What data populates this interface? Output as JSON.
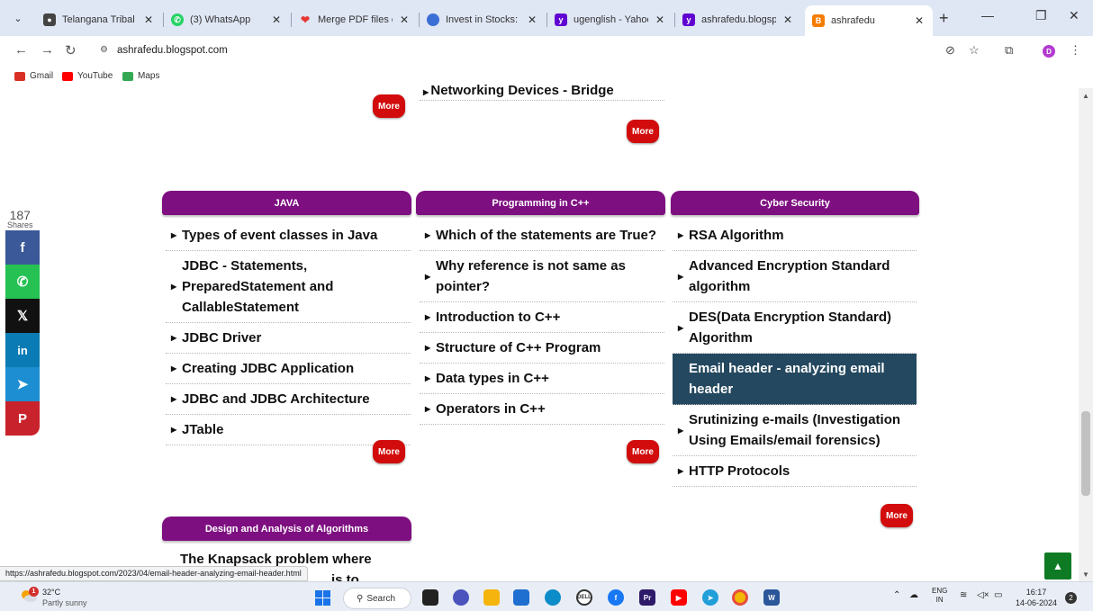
{
  "browser": {
    "tabs": [
      {
        "title": "Telangana Tribal Wel",
        "icon_color": "#444444"
      },
      {
        "title": "(3) WhatsApp",
        "icon_color": "#25d366"
      },
      {
        "title": "Merge PDF files onlin",
        "icon_color": "#e53935"
      },
      {
        "title": "Invest in Stocks: Expl",
        "icon_color": "#3b6fd6"
      },
      {
        "title": "ugenglish - Yahoo In",
        "icon_color": "#6001d2"
      },
      {
        "title": "ashrafedu.blogspot",
        "icon_color": "#6001d2"
      },
      {
        "title": "ashrafedu",
        "icon_color": "#f57c00"
      }
    ],
    "url": "ashrafedu.blogspot.com",
    "bookmarks": [
      {
        "label": "Gmail",
        "color": "#d93025"
      },
      {
        "label": "YouTube",
        "color": "#ff0000"
      },
      {
        "label": "Maps",
        "color": "#34a853"
      }
    ],
    "profile_initial": "D",
    "status_url": "https://ashrafedu.blogspot.com/2023/04/email-header-analyzing-email-header.html"
  },
  "page": {
    "top_partial_item": "Networking Devices - Bridge",
    "more_label": "More",
    "sections": [
      {
        "title": "JAVA",
        "items": [
          "Types of event classes in Java",
          "JDBC - Statements, PreparedStatement and CallableStatement",
          "JDBC Driver",
          "Creating JDBC Application",
          "JDBC and JDBC Architecture",
          "JTable"
        ]
      },
      {
        "title": "Programming in C++",
        "items": [
          "Which of the statements are True?",
          "Why reference is not same as pointer?",
          "Introduction to C++",
          "Structure of C++ Program",
          "Data types in C++",
          "Operators in C++"
        ]
      },
      {
        "title": "Cyber Security",
        "items": [
          "RSA Algorithm",
          "Advanced Encryption Standard algorithm",
          "DES(Data Encryption Standard) Algorithm",
          "Email header - analyzing email header",
          "Srutinizing e-mails (Investigation Using Emails/email forensics)",
          "HTTP Protocols"
        ],
        "highlighted_index": 3
      }
    ],
    "bottom_section": {
      "title": "Design and Analysis of Algorithms",
      "partial_line1": "The Knapsack problem where",
      "partial_line2": "is to"
    },
    "share": {
      "count": "187",
      "label": "Shares",
      "buttons": [
        {
          "name": "facebook",
          "glyph": "f",
          "color": "#3b5998"
        },
        {
          "name": "whatsapp",
          "glyph": "✆",
          "color": "#25c153"
        },
        {
          "name": "x",
          "glyph": "𝕏",
          "color": "#111111"
        },
        {
          "name": "linkedin",
          "glyph": "in",
          "color": "#0a7bb4"
        },
        {
          "name": "telegram",
          "glyph": "➤",
          "color": "#1d8ed1"
        },
        {
          "name": "pinterest",
          "glyph": "P",
          "color": "#c8232c"
        }
      ]
    }
  },
  "taskbar": {
    "weather_temp": "32°C",
    "weather_desc": "Partly sunny",
    "weather_badge": "1",
    "search_label": "Search",
    "lang_line1": "ENG",
    "lang_line2": "IN",
    "time": "16:17",
    "date": "14-06-2024",
    "notification_count": "2"
  }
}
